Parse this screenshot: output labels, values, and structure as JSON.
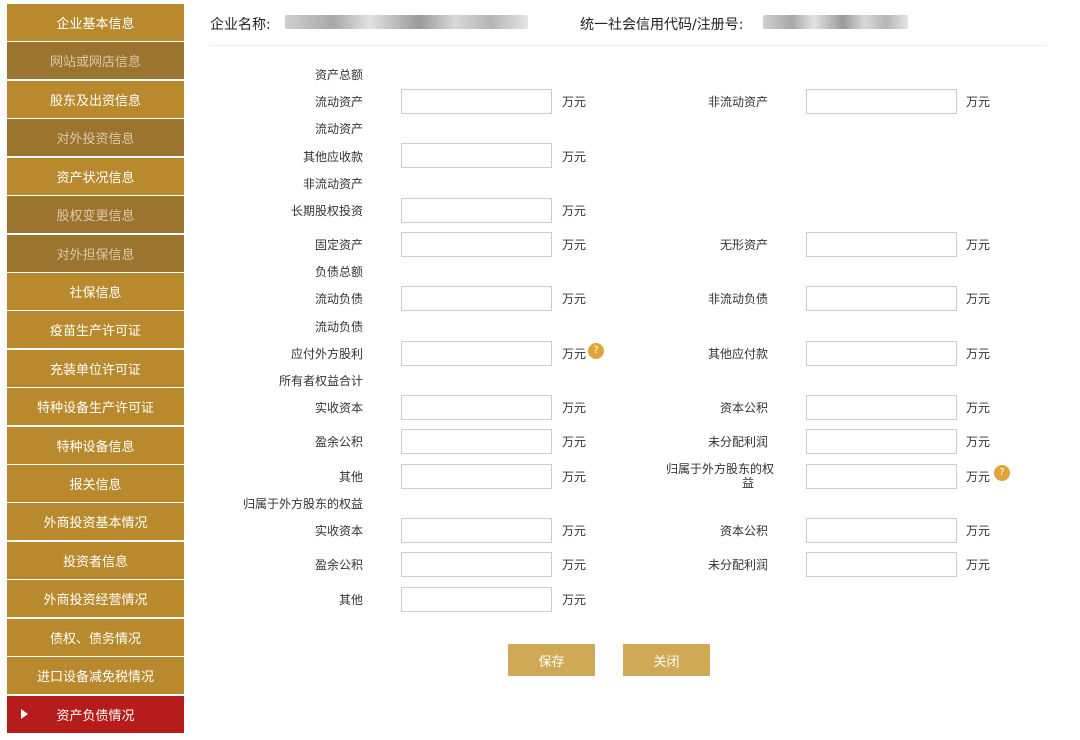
{
  "sidebar": {
    "items": [
      {
        "label": "企业基本信息"
      },
      {
        "label": "网站或网店信息"
      },
      {
        "label": "股东及出资信息"
      },
      {
        "label": "对外投资信息"
      },
      {
        "label": "资产状况信息"
      },
      {
        "label": "股权变更信息"
      },
      {
        "label": "对外担保信息"
      },
      {
        "label": "社保信息"
      },
      {
        "label": "疫苗生产许可证"
      },
      {
        "label": "充装单位许可证"
      },
      {
        "label": "特种设备生产许可证"
      },
      {
        "label": "特种设备信息"
      },
      {
        "label": "报关信息"
      },
      {
        "label": "外商投资基本情况"
      },
      {
        "label": "投资者信息"
      },
      {
        "label": "外商投资经营情况"
      },
      {
        "label": "债权、债务情况"
      },
      {
        "label": "进口设备减免税情况"
      },
      {
        "label": "资产负债情况"
      }
    ]
  },
  "header": {
    "company_label": "企业名称:",
    "code_label": "统一社会信用代码/注册号:"
  },
  "form": {
    "sections": {
      "total_assets": "资产总额",
      "current_assets": "流动资产",
      "non_current_assets": "非流动资产",
      "total_liabilities": "负债总额",
      "current_liabilities": "流动负债",
      "owners_equity": "所有者权益合计",
      "foreign_equity": "归属于外方股东的权益"
    },
    "fields": {
      "current_assets": "流动资产",
      "non_current_assets": "非流动资产",
      "other_receivables": "其他应收款",
      "long_term_equity_investment": "长期股权投资",
      "fixed_assets": "固定资产",
      "intangible_assets": "无形资产",
      "current_liabilities": "流动负债",
      "non_current_liabilities": "非流动负债",
      "dividends_payable_foreign": "应付外方股利",
      "other_payables": "其他应付款",
      "paid_in_capital": "实收资本",
      "capital_reserve": "资本公积",
      "surplus_reserve": "盈余公积",
      "undistributed_profit": "未分配利润",
      "other": "其他",
      "foreign_equity_line1": "归属于外方股东的权",
      "foreign_equity_line2": "益"
    },
    "unit": "万元",
    "help_glyph": "?"
  },
  "buttons": {
    "save": "保存",
    "close": "关闭"
  },
  "colors": {
    "sidebar_bg": "#b88a2d",
    "sidebar_dim_bg": "#9b7430",
    "sidebar_active_bg": "#b71c1c",
    "button_bg": "#cfa955",
    "help_icon": "#e0a43a"
  }
}
